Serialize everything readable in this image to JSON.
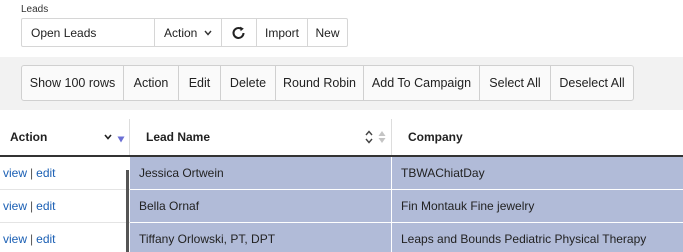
{
  "header": {
    "label": "Leads"
  },
  "view_bar": {
    "view_name": "Open Leads",
    "action_label": "Action",
    "refresh_icon": "refresh-icon",
    "import_label": "Import",
    "new_label": "New"
  },
  "toolbar": {
    "buttons": [
      "Show 100 rows",
      "Action",
      "Edit",
      "Delete",
      "Round Robin",
      "Add To Campaign",
      "Select All",
      "Deselect All"
    ]
  },
  "table": {
    "columns": {
      "action": "Action",
      "lead_name": "Lead Name",
      "company": "Company"
    },
    "action_links": {
      "view": "view",
      "separator": "|",
      "edit": "edit"
    },
    "rows": [
      {
        "lead_name": "Jessica Ortwein",
        "company": "TBWAChiatDay"
      },
      {
        "lead_name": "Bella Ornaf",
        "company": "Fin Montauk Fine jewelry"
      },
      {
        "lead_name": "Tiffany Orlowski, PT, DPT",
        "company": "Leaps and Bounds Pediatric Physical Therapy"
      }
    ]
  },
  "colors": {
    "selected_row": "#b1bbd8",
    "link": "#1a5fb4",
    "sort_indicator": "#6b6fd4"
  }
}
